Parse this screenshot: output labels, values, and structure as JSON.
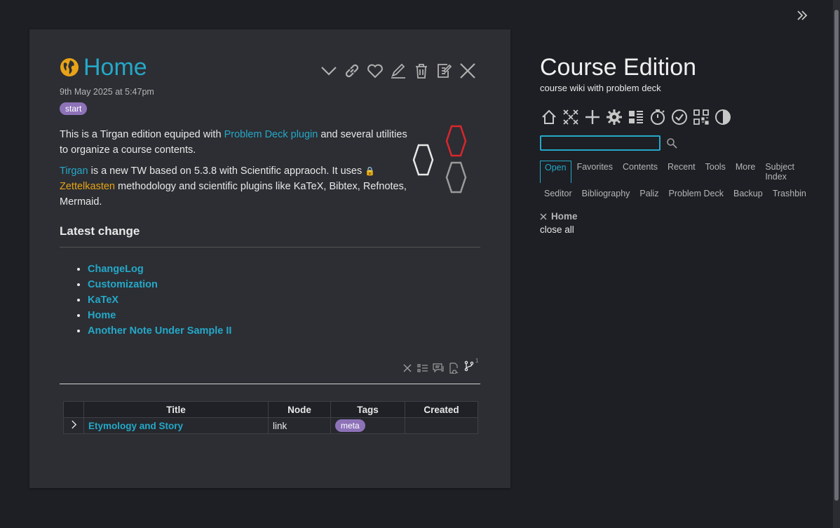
{
  "story": {
    "title": "Home",
    "date": "9th May 2025 at 5:47pm",
    "tag": "start",
    "para1": {
      "t1": "This is a Tirgan edition equiped with ",
      "link1": "Problem Deck plugin",
      "t2": " and several utilities to organize a course contents."
    },
    "para2": {
      "link1": "Tirgan",
      "t1": " is a new TW based on 5.3.8 with Scientific appraoch. It uses ",
      "link2": "Zettelkasten",
      "t2": " methodology and scientific plugins like KaTeX, Bibtex, Refnotes, Mermaid."
    },
    "heading": "Latest change",
    "changes": [
      "ChangeLog",
      "Customization",
      "KaTeX",
      "Home",
      "Another Note Under Sample II"
    ],
    "table": {
      "headers": [
        "Title",
        "Node",
        "Tags",
        "Created"
      ],
      "rows": [
        {
          "title": "Etymology and Story",
          "node": "link",
          "tag": "meta",
          "created": ""
        }
      ]
    },
    "mini_badge": "1"
  },
  "sidebar": {
    "site_title": "Course Edition",
    "site_subtitle": "course wiki with problem deck",
    "search": {
      "value": "",
      "placeholder": ""
    },
    "tabs_row1": [
      "Open",
      "Favorites",
      "Contents",
      "Recent",
      "Tools",
      "More",
      "Subject Index"
    ],
    "tabs_row2": [
      "Seditor",
      "Bibliography",
      "Paliz",
      "Problem Deck",
      "Backup",
      "Trashbin"
    ],
    "open_items": [
      "Home"
    ],
    "close_all": "close all"
  },
  "colors": {
    "accent": "#25a8c9",
    "tag": "#8d72b8",
    "link_orange": "#e8a317",
    "hex_red": "#d9262c"
  }
}
